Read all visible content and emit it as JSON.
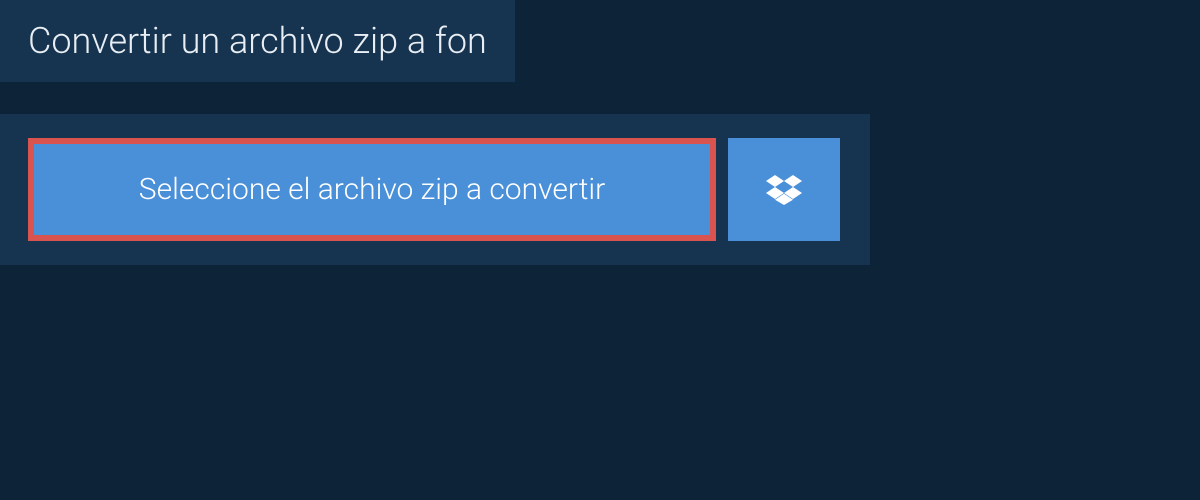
{
  "header": {
    "title": "Convertir un archivo zip a fon"
  },
  "panel": {
    "select_label": "Seleccione el archivo zip a convertir",
    "dropbox_icon": "dropbox-icon"
  },
  "colors": {
    "background": "#0d2438",
    "panel": "#163450",
    "button": "#4a90d9",
    "highlight_border": "#d9534f",
    "text_light": "#e8eef3",
    "text_white": "#ffffff"
  }
}
